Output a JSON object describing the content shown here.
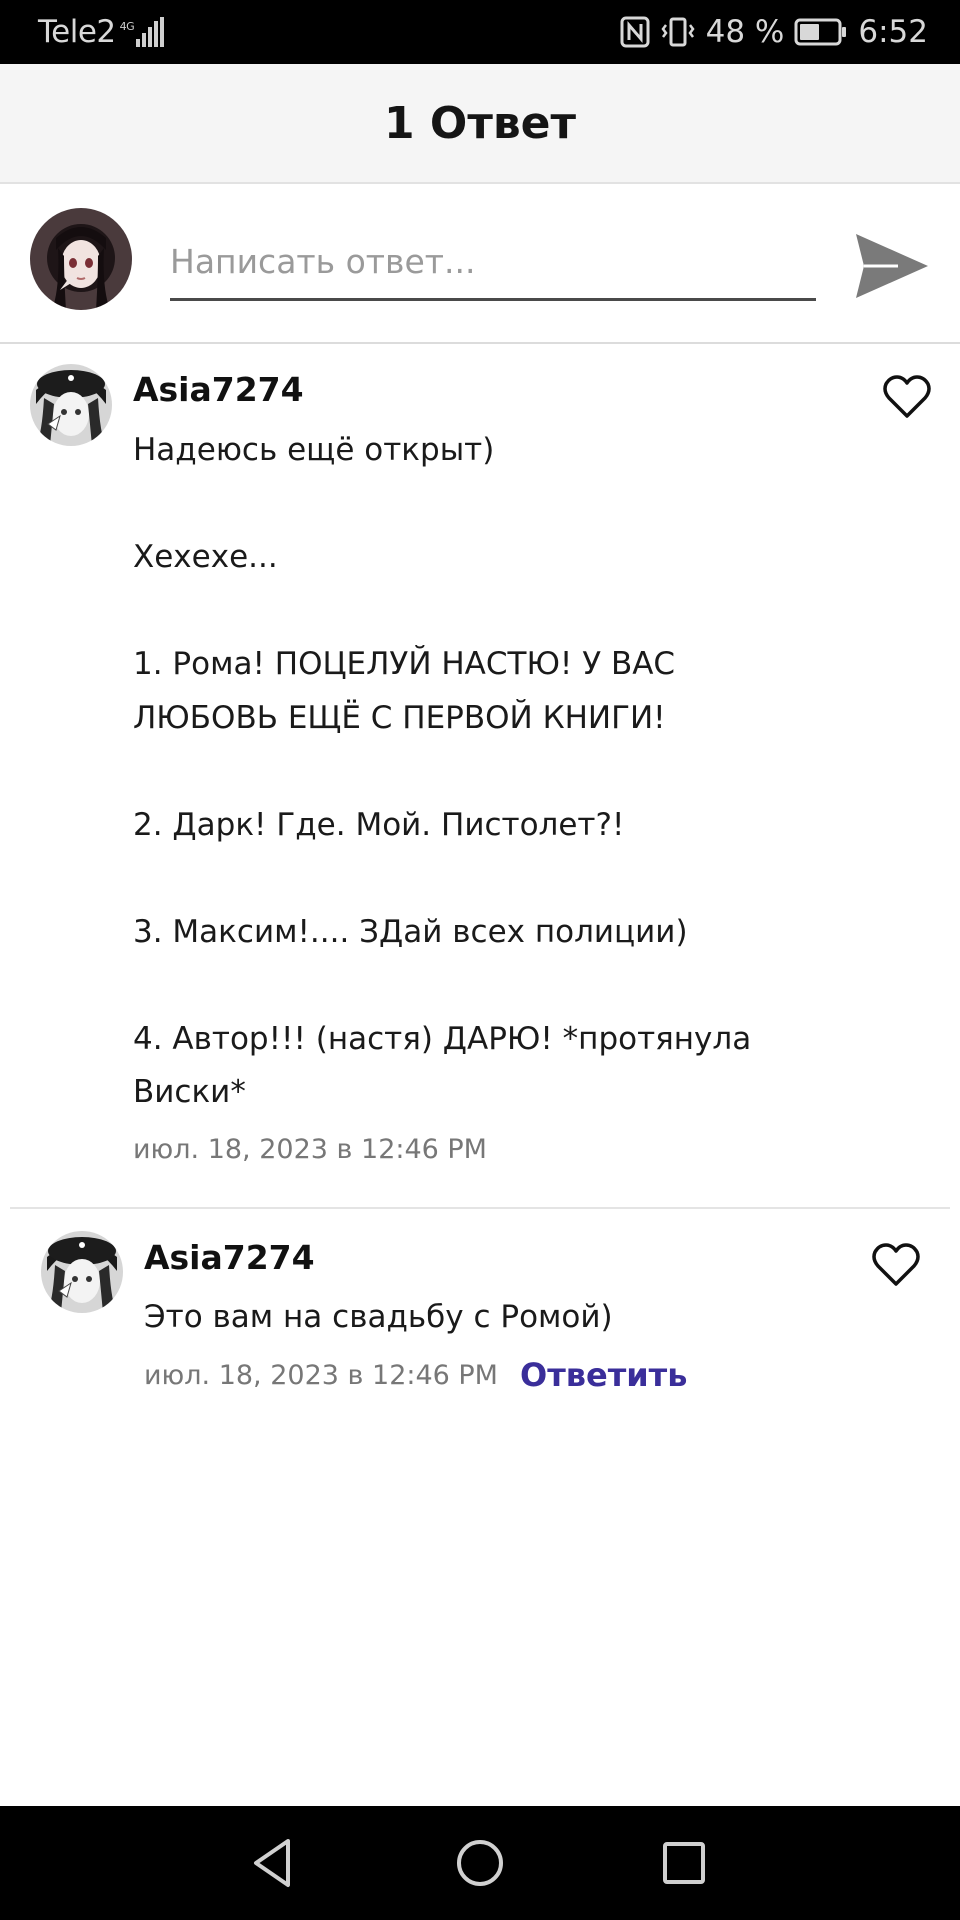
{
  "status_bar": {
    "carrier": "Tele2",
    "network": "4G",
    "battery_percent": "48 %",
    "time": "6:52"
  },
  "header": {
    "title": "1 Ответ"
  },
  "composer": {
    "placeholder": "Написать ответ..."
  },
  "comments": [
    {
      "username": "Asia7274",
      "text": "Надеюсь ещё открыт)\n\nХехехе...\n\n1. Рома! ПОЦЕЛУЙ НАСТЮ! У ВАС\nЛЮБОВЬ ЕЩЁ С ПЕРВОЙ КНИГИ!\n\n2. Дарк! Где. Мой. Пистолет?!\n\n3. Максим!.... ЗДай всех полиции)\n\n4. Автор!!! (настя) ДАРЮ! *протянула\nВиски*",
      "timestamp": "июл. 18, 2023 в 12:46 PM"
    },
    {
      "username": "Asia7274",
      "text": "Это вам на свадьбу с Ромой)",
      "timestamp": "июл. 18, 2023 в 12:46 PM",
      "reply_label": "Ответить"
    }
  ],
  "colors": {
    "accent": "#3a2e9a",
    "header_bg": "#f5f5f5",
    "system_bar": "#000000"
  },
  "icons": {
    "send": "send-icon",
    "like": "heart-outline-icon",
    "nav_back": "back-triangle-icon",
    "nav_home": "home-circle-icon",
    "nav_recents": "recents-square-icon"
  }
}
